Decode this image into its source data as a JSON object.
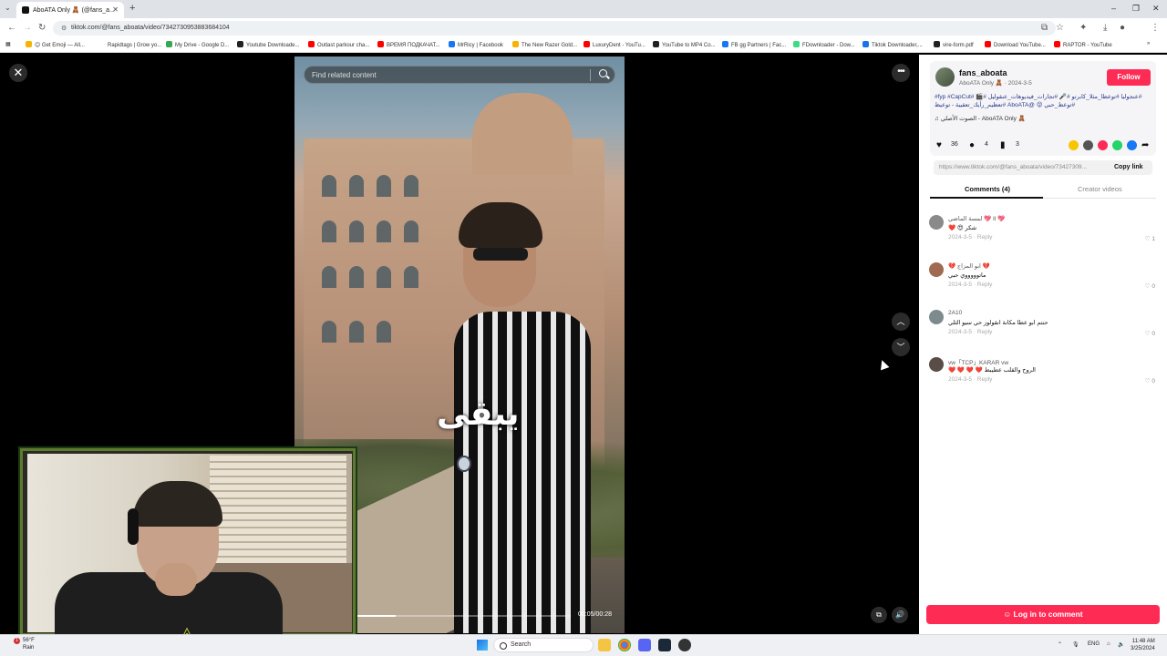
{
  "browser": {
    "tab_title": "AboATA Only 🧸 (@fans_a...",
    "url": "tiktok.com/@fans_aboata/video/7342730953883684104",
    "bookmarks": [
      "😊 Get Emoji — All...",
      "Rapidtags | Grow yo...",
      "My Drive - Google D...",
      "Youtube Downloade...",
      "Outlast parkour cha...",
      "ВРЕМЯ ПОДКАЧАТ...",
      "MrRicy | Facebook",
      "The New Razer Gold...",
      "LuxuryDent - YouTu...",
      "YouTube to MP4 Co...",
      "FB gg Partners | Fac...",
      "FDownloader - Dow...",
      "Tiktok Downloader,...",
      "vire-form.pdf",
      "Download YouTube...",
      "RAPTOR - YouTube"
    ]
  },
  "viewer": {
    "search_placeholder": "Find related content",
    "video_overlay_text": "يبقى",
    "timecode": "00:05/00:28",
    "progress_fraction": 0.18
  },
  "panel": {
    "author": "fans_aboata",
    "author_sub": "AboATA Only 🧸 · 2024-3-5",
    "follow_label": "Follow",
    "description": "#عنجولیا #توعظا_مثلا_كابرتو #🎤 #تجارات_فيديوهات_عنقوليل #🎬 #fyp #CapCut# #توعظ_حبي 😝 @AboATA #تعظيم_رأیك_تعقيبة - توعيظ",
    "music": "♫ الصوت الأصلي - AboATA Only 🧸",
    "likes": "36",
    "comments_count": "4",
    "saves": "3",
    "share_url": "https://www.tiktok.com/@fans_aboata/video/73427309...",
    "copy_link_label": "Copy link",
    "tab_comments": "Comments (4)",
    "tab_creator": "Creator videos",
    "comments": [
      {
        "name": "لمسة الماضي 💖 II 💖",
        "text": "❤️ 😍 شكر",
        "meta": "2024-3-5 · Reply",
        "likes": "♡ 1"
      },
      {
        "name": "💔 ابو المزاج 💔",
        "text": "ماتوووووي حبي",
        "meta": "2024-3-5 · Reply",
        "likes": "♡ 0"
      },
      {
        "name": "2A10",
        "text": "حنتم ابو عطا مكانة انقولوز حي سيو الثلي",
        "meta": "2024-3-5 · Reply",
        "likes": "♡ 0"
      },
      {
        "name": "vw「TCP」KARAR vw",
        "text": "❤️ ❤️ ❤️ ❤️ الروح والقلب عطيبط",
        "meta": "2024-3-5 · Reply",
        "likes": "♡ 0"
      }
    ],
    "login_label": "Log in to comment"
  },
  "taskbar": {
    "weather_temp": "56°F",
    "weather_label": "Rain",
    "search_label": "Search",
    "lang": "ENG",
    "time": "11:48 AM",
    "date": "3/25/2024"
  },
  "colors": {
    "tiktok_red": "#fe2c55"
  }
}
